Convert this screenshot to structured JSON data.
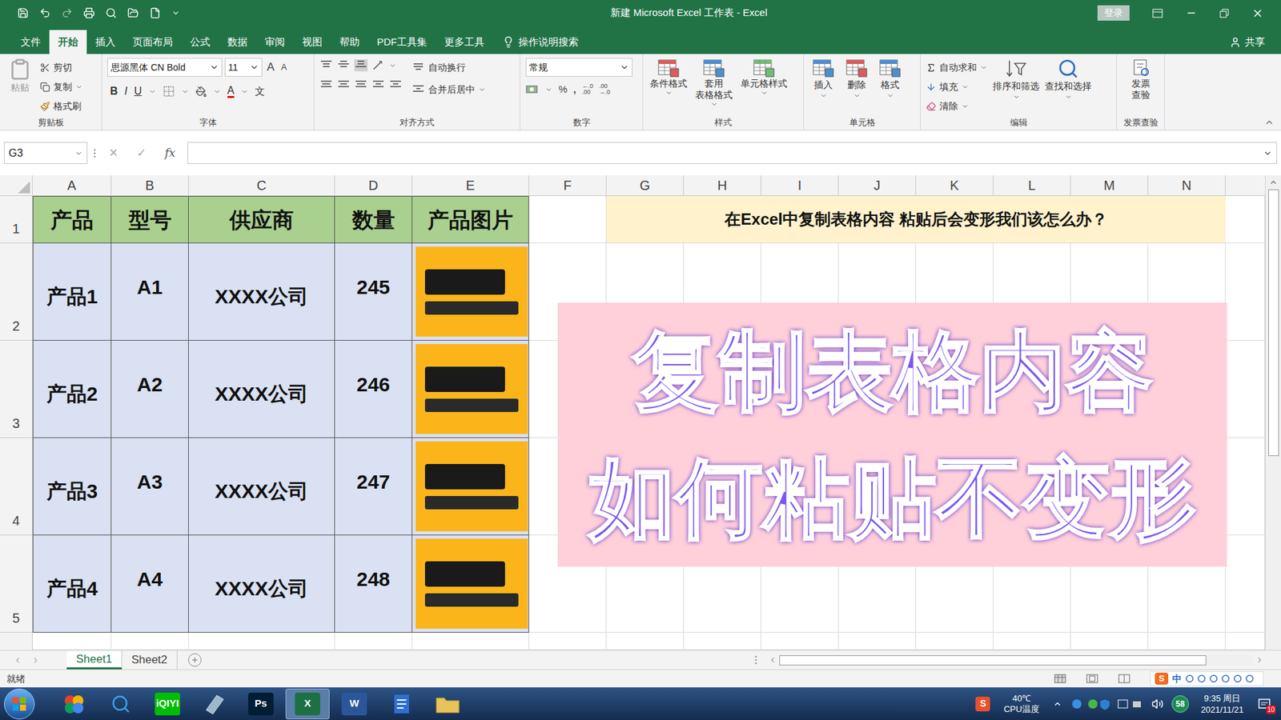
{
  "window": {
    "title": "新建 Microsoft Excel 工作表  -  Excel",
    "login": "登录"
  },
  "menu_tabs": [
    {
      "label": "文件",
      "selected": false
    },
    {
      "label": "开始",
      "selected": true
    },
    {
      "label": "插入",
      "selected": false
    },
    {
      "label": "页面布局",
      "selected": false
    },
    {
      "label": "公式",
      "selected": false
    },
    {
      "label": "数据",
      "selected": false
    },
    {
      "label": "审阅",
      "selected": false
    },
    {
      "label": "视图",
      "selected": false
    },
    {
      "label": "帮助",
      "selected": false
    },
    {
      "label": "PDF工具集",
      "selected": false
    },
    {
      "label": "更多工具",
      "selected": false
    }
  ],
  "tell_me": "操作说明搜索",
  "share": "共享",
  "ribbon": {
    "clipboard": {
      "label": "剪贴板",
      "paste": "粘贴",
      "items": [
        "剪切",
        "复制",
        "格式刷"
      ]
    },
    "font": {
      "label": "字体",
      "family": "思源黑体 CN Bold",
      "size": "11",
      "grow": "A",
      "shrink": "A",
      "bold": "B",
      "italic": "I",
      "underline": "U",
      "font_color": "A",
      "phonetic": "文"
    },
    "alignment": {
      "label": "对齐方式",
      "wrap": "自动换行",
      "merge": "合并后居中"
    },
    "number": {
      "label": "数字",
      "format": "常规",
      "percent": "%",
      "comma": ",",
      "decimals": [
        {
          "top": "←.0",
          "bottom": ".00"
        },
        {
          "top": ".00",
          "bottom": "→.0"
        }
      ]
    },
    "styles": {
      "label": "样式",
      "buttons": [
        {
          "lines": [
            "条件格式"
          ]
        },
        {
          "lines": [
            "套用",
            "表格格式"
          ]
        },
        {
          "lines": [
            "单元格样式"
          ]
        }
      ]
    },
    "cells": {
      "label": "单元格",
      "buttons": [
        "插入",
        "删除",
        "格式"
      ]
    },
    "editing": {
      "label": "编辑",
      "small": [
        "自动求和",
        "填充",
        "清除"
      ],
      "big": [
        "排序和筛选",
        "查找和选择"
      ]
    },
    "invoice": {
      "label": "发票查验",
      "lines": [
        "发票",
        "查验"
      ]
    }
  },
  "formula_bar": {
    "name_box": "G3",
    "cancel": "✕",
    "enter": "✓",
    "fx": "fx"
  },
  "sheet": {
    "columns": [
      "A",
      "B",
      "C",
      "D",
      "E",
      "F",
      "G",
      "H",
      "I",
      "J",
      "K",
      "L",
      "M",
      "N"
    ],
    "row_numbers": [
      "1",
      "2",
      "3",
      "4",
      "5"
    ],
    "header": [
      "产品",
      "型号",
      "供应商",
      "数量",
      "产品图片"
    ],
    "rows": [
      {
        "product": "产品1",
        "model": "A1",
        "supplier": "XXXX公司",
        "quantity": "245"
      },
      {
        "product": "产品2",
        "model": "A2",
        "supplier": "XXXX公司",
        "quantity": "246"
      },
      {
        "product": "产品3",
        "model": "A3",
        "supplier": "XXXX公司",
        "quantity": "247"
      },
      {
        "product": "产品4",
        "model": "A4",
        "supplier": "XXXX公司",
        "quantity": "248"
      }
    ],
    "note": "在Excel中复制表格内容 粘贴后会变形我们该怎么办？"
  },
  "overlay": {
    "lines": [
      "复制表格内容",
      "如何粘贴不变形"
    ]
  },
  "sheet_tabs": [
    {
      "label": "Sheet1",
      "selected": true
    },
    {
      "label": "Sheet2",
      "selected": false
    }
  ],
  "status_bar": {
    "text": "就绪",
    "ime": "中"
  },
  "taskbar": {
    "apps": [
      {
        "kind": "balls",
        "label": "",
        "color": "#e0442f",
        "selected": false
      },
      {
        "kind": "search",
        "label": "",
        "color": "#3aa0e8",
        "selected": false
      },
      {
        "kind": "badge",
        "label": "iQIYI",
        "color": "#00be06",
        "selected": false
      },
      {
        "kind": "pad",
        "label": "",
        "color": "#9bb8c8",
        "selected": false
      },
      {
        "kind": "badge",
        "label": "Ps",
        "color": "#001d34",
        "selected": false
      },
      {
        "kind": "badge",
        "label": "X",
        "color": "#1d7044",
        "selected": true
      },
      {
        "kind": "badge",
        "label": "W",
        "color": "#2b579a",
        "selected": false
      },
      {
        "kind": "doc",
        "label": "",
        "color": "#2f6fd6",
        "selected": false
      },
      {
        "kind": "folder",
        "label": "",
        "color": "#e9c25a",
        "selected": false
      }
    ],
    "ime_logo": "S",
    "temperature": "40℃",
    "temperature_label": "CPU温度",
    "badge": "58",
    "time": "9:35 周日",
    "date": "2021/11/21",
    "notifications": "10"
  }
}
